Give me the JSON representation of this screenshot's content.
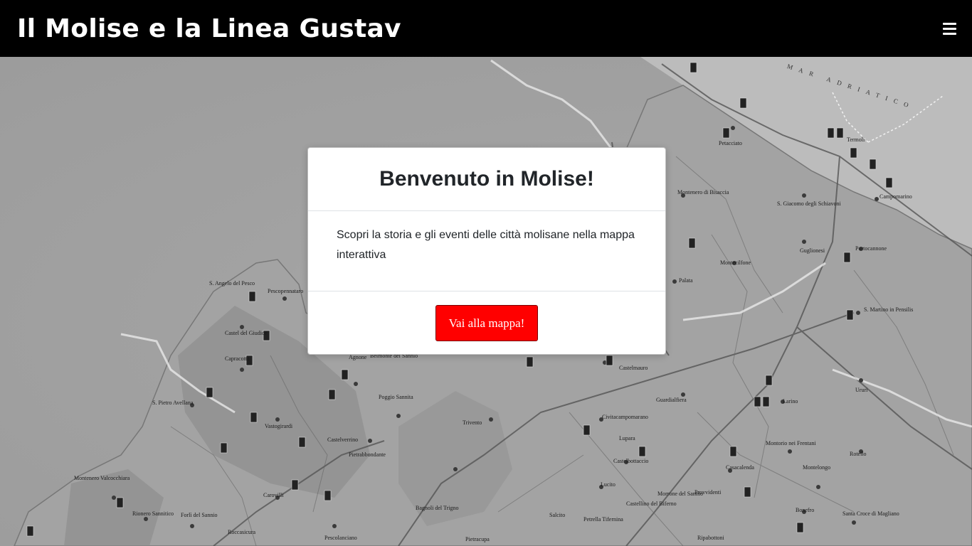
{
  "navbar": {
    "brand": "Il Molise e la Linea Gustav",
    "menu_icon": "hamburger-menu-icon"
  },
  "map": {
    "sea_label": "MAR ADRIATICO",
    "places": [
      "Termoli",
      "Petacciato",
      "Campomarino",
      "S. Giacomo degli Schiavoni",
      "Montenero di Bisaccia",
      "Guglionesi",
      "Portocannone",
      "Montecilfone",
      "Palata",
      "S. Martino in Pensilis",
      "Ururi",
      "Larino",
      "Montorio nei Frentani",
      "Rotello",
      "Casacalenda",
      "Montelongo",
      "Bonefro",
      "Santa Croce di Magliano",
      "Ripabottoni",
      "Morrone del Sannio",
      "Provvidenti",
      "Castelmauro",
      "Guardialfiera",
      "Civitacampomarano",
      "Lupara",
      "Castelbottaccio",
      "Lucito",
      "Trivento",
      "Salcito",
      "Bagnoli del Trigno",
      "Pietracupa",
      "Poggio Sannita",
      "Agnone",
      "Belmonte del Sannio",
      "Castelverrino",
      "Pietrabbondante",
      "S. Angelo del Pesco",
      "Pescopennataro",
      "Castel del Giudice",
      "Capracotta",
      "S. Pietro Avellana",
      "Vastogirardi",
      "Carovilli",
      "Pescolanciano",
      "Montenero Valcocchiara",
      "Rionero Sannitico",
      "Forlì del Sannio",
      "Roccasicura",
      "Castelverrino",
      "Petrella Tifernina",
      "Castellino del Biferno"
    ]
  },
  "modal": {
    "title": "Benvenuto in Molise!",
    "body_text": "Scopri la storia e gli eventi delle città molisane nella mappa interattiva",
    "button_label": "Vai alla mappa!",
    "button_color": "#ff0000"
  },
  "colors": {
    "navbar_bg": "#000000",
    "map_tint": "#a6a6a6"
  }
}
